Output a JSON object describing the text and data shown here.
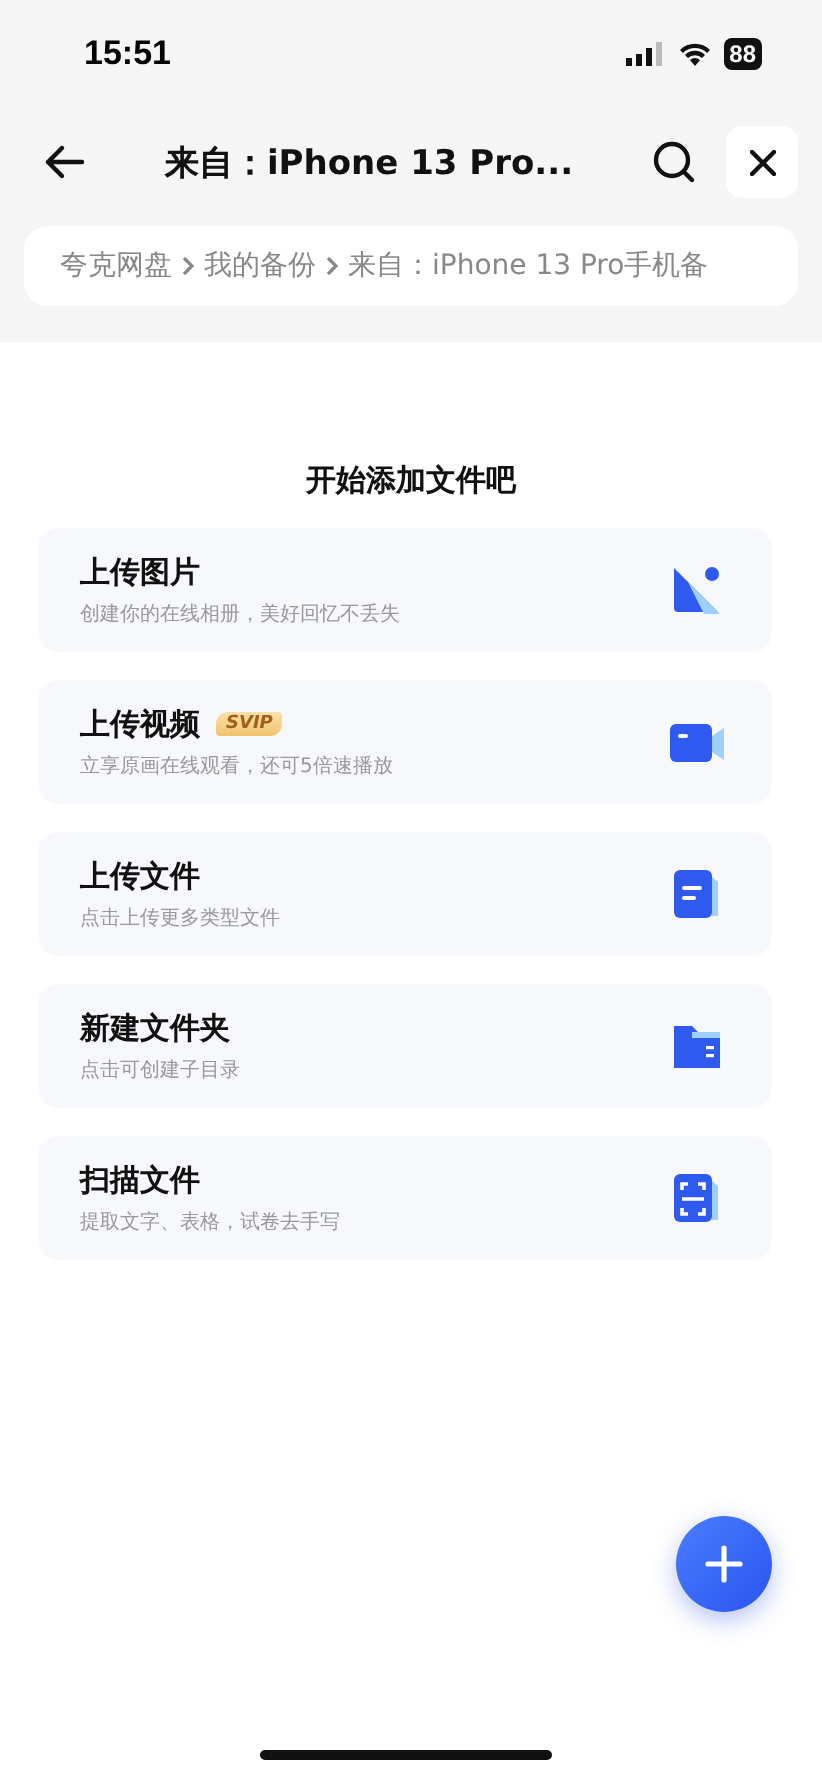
{
  "status_bar": {
    "time": "15:51",
    "battery": "88"
  },
  "header": {
    "title": "来自：iPhone 13 Pro..."
  },
  "breadcrumb": [
    "夸克网盘",
    "我的备份",
    "来自：iPhone 13 Pro手机备"
  ],
  "heading": "开始添加文件吧",
  "actions": [
    {
      "kind": "photo",
      "title": "上传图片",
      "subtitle": "创建你的在线相册，美好回忆不丢失"
    },
    {
      "kind": "video",
      "title": "上传视频",
      "badge": "SVIP",
      "subtitle": "立享原画在线观看，还可5倍速播放"
    },
    {
      "kind": "file",
      "title": "上传文件",
      "subtitle": "点击上传更多类型文件"
    },
    {
      "kind": "folder",
      "title": "新建文件夹",
      "subtitle": "点击可创建子目录"
    },
    {
      "kind": "scan",
      "title": "扫描文件",
      "subtitle": "提取文字、表格，试卷去手写"
    }
  ]
}
